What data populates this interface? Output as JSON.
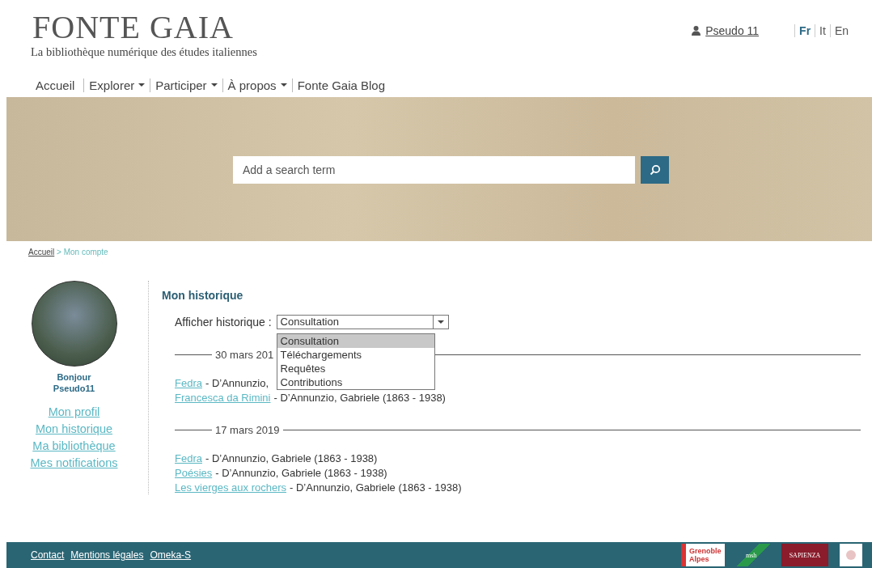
{
  "logo": {
    "title": "FONTE GAIA",
    "tagline": "La bibliothèque numérique des études italiennes"
  },
  "user": {
    "name": "Pseudo 11"
  },
  "languages": [
    {
      "label": "Fr",
      "selected": true
    },
    {
      "label": "It",
      "selected": false
    },
    {
      "label": "En",
      "selected": false
    }
  ],
  "nav": [
    {
      "label": "Accueil",
      "dropdown": false
    },
    {
      "label": "Explorer",
      "dropdown": true
    },
    {
      "label": "Participer",
      "dropdown": true
    },
    {
      "label": "À propos",
      "dropdown": true
    },
    {
      "label": "Fonte Gaia Blog",
      "dropdown": false
    }
  ],
  "search": {
    "placeholder": "Add a search term"
  },
  "breadcrumb": {
    "link": "Accueil",
    "separator": ">",
    "current": "Mon compte"
  },
  "sidebar": {
    "greeting": "Bonjour",
    "username": "Pseudo11",
    "items": [
      {
        "label": "Mon profil"
      },
      {
        "label": "Mon historique"
      },
      {
        "label": "Ma bibliothèque"
      },
      {
        "label": "Mes notifications"
      }
    ]
  },
  "history": {
    "title": "Mon historique",
    "filter_label": "Afficher historique :",
    "filter_value": "Consultation",
    "options": [
      {
        "label": "Consultation",
        "selected": true
      },
      {
        "label": "Téléchargements",
        "selected": false
      },
      {
        "label": "Requêtes",
        "selected": false
      },
      {
        "label": "Contributions",
        "selected": false
      }
    ],
    "groups": [
      {
        "date": "30 mars 201",
        "entries": [
          {
            "title": "Fedra",
            "author": "- D’Annunzio,"
          },
          {
            "title": "Francesca da Rimini",
            "author": "- D’Annunzio, Gabriele (1863 - 1938)"
          }
        ]
      },
      {
        "date": "17 mars 2019",
        "entries": [
          {
            "title": "Fedra",
            "author": "- D’Annunzio, Gabriele (1863 - 1938)"
          },
          {
            "title": "Poésies",
            "author": "- D’Annunzio, Gabriele (1863 - 1938)"
          },
          {
            "title": "Les vierges aux rochers",
            "author": "- D’Annunzio, Gabriele (1863 - 1938)"
          }
        ]
      }
    ]
  },
  "footer": {
    "links": [
      "Contact",
      "Mentions légales",
      "Omeka-S"
    ],
    "logos": [
      {
        "kind": "grenoble",
        "text": "Grenoble Alpes"
      },
      {
        "kind": "msh",
        "text": "msh"
      },
      {
        "kind": "sapienza",
        "text": "SAPIENZA"
      },
      {
        "kind": "seal"
      }
    ]
  }
}
